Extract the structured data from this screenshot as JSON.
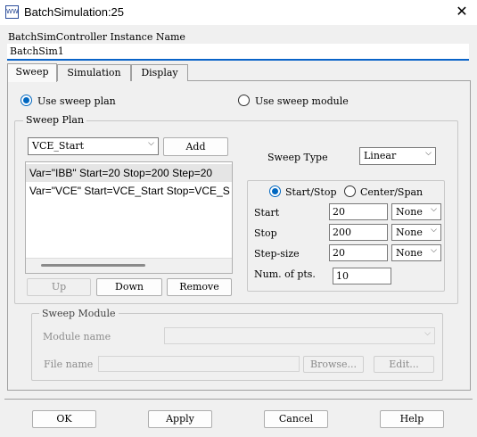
{
  "window": {
    "title": "BatchSimulation:25",
    "icon": "app-icon",
    "close": "✕"
  },
  "instance": {
    "label": "BatchSimController Instance Name",
    "value": "BatchSim1"
  },
  "tabs": [
    {
      "label": "Sweep",
      "active": true
    },
    {
      "label": "Simulation",
      "active": false
    },
    {
      "label": "Display",
      "active": false
    }
  ],
  "sweep": {
    "use_plan_label": "Use sweep plan",
    "use_module_label": "Use sweep module",
    "plan_group_title": "Sweep Plan",
    "var_select": "VCE_Start",
    "add_label": "Add",
    "list": [
      "Var=\"IBB\" Start=20 Stop=200 Step=20",
      "Var=\"VCE\" Start=VCE_Start Stop=VCE_S"
    ],
    "up_label": "Up",
    "down_label": "Down",
    "remove_label": "Remove",
    "sweep_type_label": "Sweep Type",
    "sweep_type_value": "Linear",
    "start_stop_label": "Start/Stop",
    "center_span_label": "Center/Span",
    "start_label": "Start",
    "start_value": "20",
    "start_unit": "None",
    "stop_label": "Stop",
    "stop_value": "200",
    "stop_unit": "None",
    "step_label": "Step-size",
    "step_value": "20",
    "step_unit": "None",
    "npts_label": "Num. of pts.",
    "npts_value": "10"
  },
  "module": {
    "group_title": "Sweep Module",
    "module_name_label": "Module name",
    "file_name_label": "File name",
    "browse_label": "Browse...",
    "edit_label": "Edit..."
  },
  "footer": {
    "ok": "OK",
    "apply": "Apply",
    "cancel": "Cancel",
    "help": "Help"
  },
  "colors": {
    "accent": "#0067c0",
    "focus_underline": "#0a64c8",
    "selection": "#e5e5e5"
  }
}
